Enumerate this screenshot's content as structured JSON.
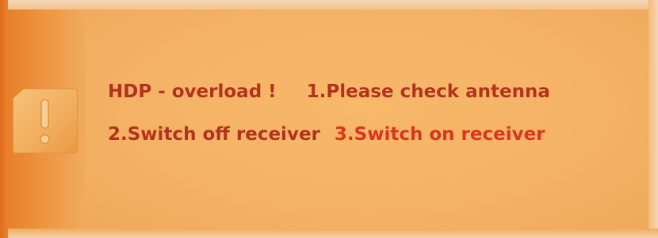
{
  "dialog": {
    "icon": "exclamation-icon",
    "line1": {
      "error": "HDP - overload !",
      "step1": "1.Please check antenna"
    },
    "line2": {
      "step2": "2.Switch off receiver",
      "step3": "3.Switch on receiver"
    }
  },
  "colors": {
    "background": "#f2b66b",
    "left_strip": "#ec8f3a",
    "text_dark_red": "#b3321c",
    "text_red": "#d9361c"
  }
}
